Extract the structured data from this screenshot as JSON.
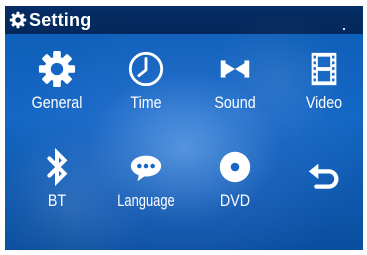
{
  "title": "Setting",
  "menu": {
    "general": "General",
    "time": "Time",
    "sound": "Sound",
    "video": "Video",
    "bt": "BT",
    "language": "Language",
    "dvd": "DVD"
  },
  "icons": {
    "title": "gear-icon",
    "general": "gear-icon",
    "time": "clock-icon",
    "sound": "sound-icon",
    "video": "film-icon",
    "bt": "bluetooth-icon",
    "language": "speech-bubble-icon",
    "dvd": "disc-icon",
    "back": "back-arrow-icon"
  },
  "colors": {
    "title_bar": "#04285a",
    "background": "#1467c4",
    "icon": "#ffffff"
  }
}
